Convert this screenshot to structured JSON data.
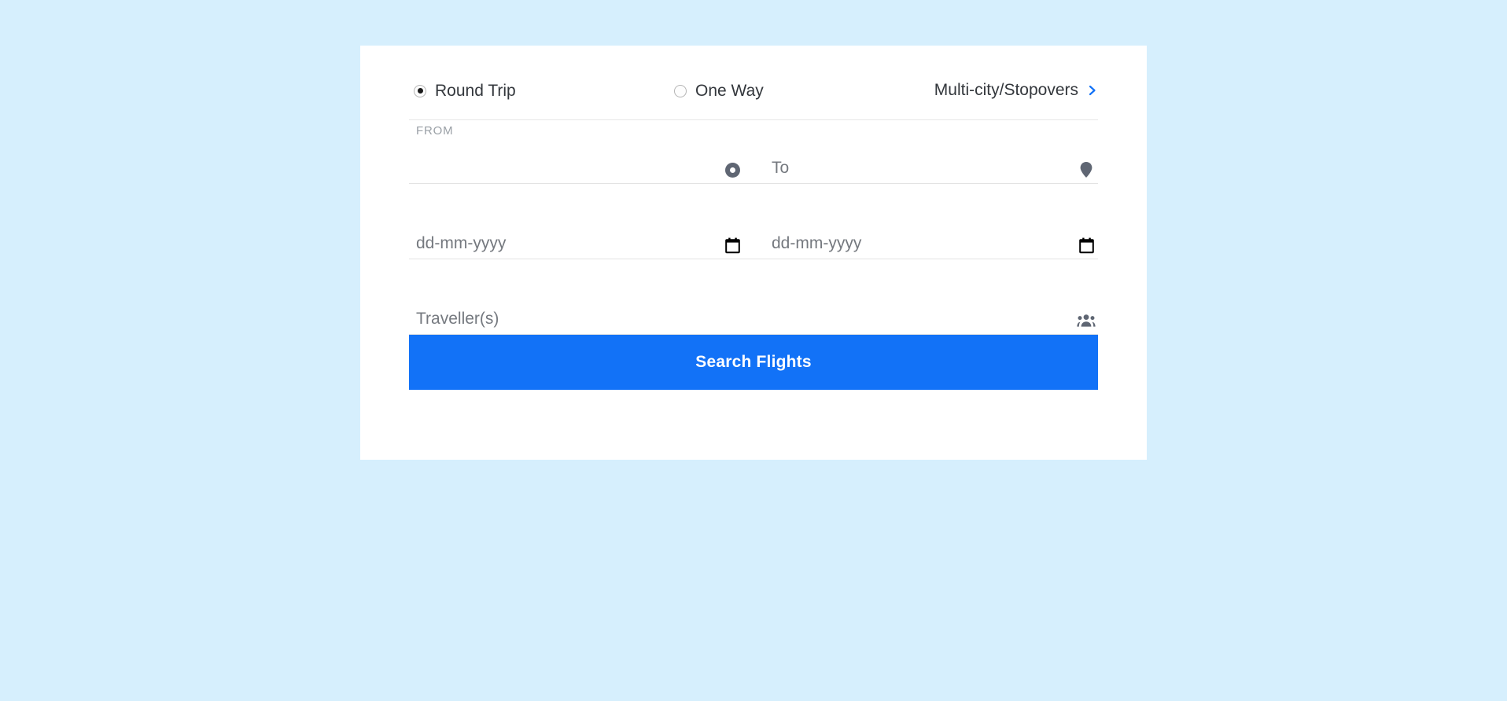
{
  "theme": {
    "page_background": "#d6effd",
    "card_background": "#ffffff",
    "accent_blue": "#1272f7",
    "text_primary": "#33373c",
    "text_muted": "#75797f",
    "label_muted": "#9aa0a6",
    "icon_gray": "#5f6673",
    "divider": "#e3e3e3"
  },
  "trip_type": {
    "options": [
      {
        "label": "Round Trip",
        "selected": true
      },
      {
        "label": "One Way",
        "selected": false
      }
    ],
    "multi_city": {
      "label": "Multi-city/Stopovers",
      "icon": "chevron-right-icon",
      "icon_color": "#1272f7"
    }
  },
  "search_form": {
    "origin": {
      "float_label": "FROM",
      "value": "",
      "placeholder": "",
      "icon": "origin-dot-icon"
    },
    "destination": {
      "value": "",
      "placeholder": "To",
      "icon": "map-pin-icon"
    },
    "depart_date": {
      "value": "",
      "placeholder": "dd-mm-yyyy",
      "icon": "calendar-icon"
    },
    "return_date": {
      "value": "",
      "placeholder": "dd-mm-yyyy",
      "icon": "calendar-icon"
    },
    "travellers": {
      "value": "",
      "placeholder": "Traveller(s)",
      "icon": "people-group-icon"
    },
    "submit": {
      "label": "Search Flights"
    }
  }
}
